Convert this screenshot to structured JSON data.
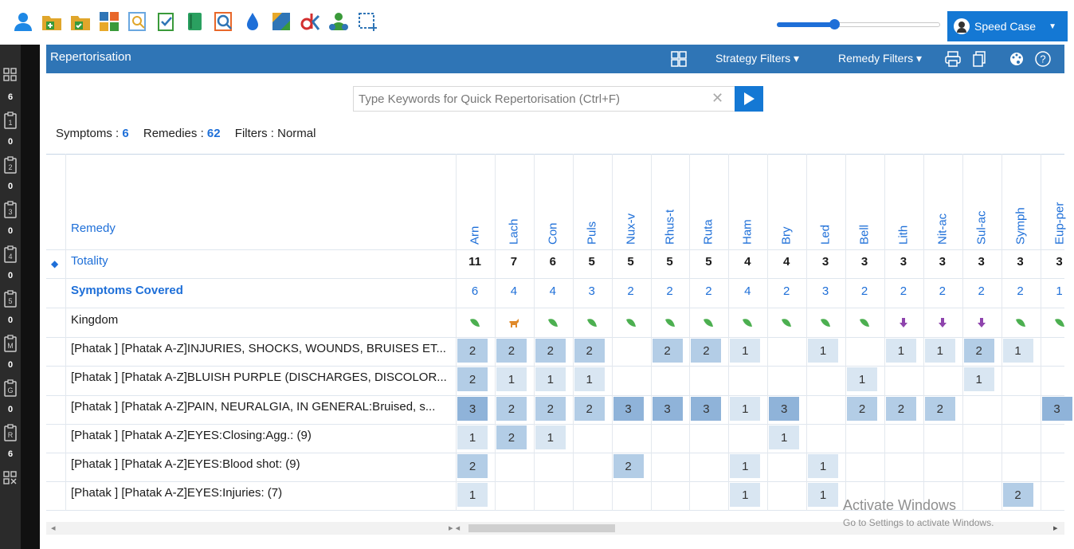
{
  "toolbar": {
    "icons": [
      "user-icon",
      "open-case-icon",
      "verified-folder-icon",
      "apps-grid-icon",
      "search-repertory-icon",
      "clipboard-icon",
      "book-icon",
      "zoom-search-icon",
      "drop-icon",
      "remedy-picture-icon",
      "dk-logo-icon",
      "patients-icon",
      "selection-icon"
    ]
  },
  "speed_case": {
    "label": "Speed Case"
  },
  "rail": {
    "items": [
      {
        "icon": "grid-icon",
        "count": "6"
      },
      {
        "icon": "clipboard-1-icon",
        "count": "0"
      },
      {
        "icon": "clipboard-2-icon",
        "count": "0"
      },
      {
        "icon": "clipboard-3-icon",
        "count": "0"
      },
      {
        "icon": "clipboard-4-icon",
        "count": "0"
      },
      {
        "icon": "clipboard-5-icon",
        "count": "0"
      },
      {
        "icon": "clipboard-m-icon",
        "count": "0"
      },
      {
        "icon": "clipboard-g-icon",
        "count": "0"
      },
      {
        "icon": "clipboard-r-icon",
        "count": "6"
      },
      {
        "icon": "grid-x-icon",
        "count": ""
      }
    ]
  },
  "header": {
    "title": "Repertorisation",
    "strategy_filters": "Strategy Filters",
    "remedy_filters": "Remedy Filters"
  },
  "search": {
    "placeholder": "Type Keywords for Quick Repertorisation (Ctrl+F)",
    "clear": "✕"
  },
  "summary": {
    "symptoms_label": "Symptoms :",
    "symptoms_value": "6",
    "remedies_label": "Remedies :",
    "remedies_value": "62",
    "filters_label": "Filters :",
    "filters_value": "Normal"
  },
  "table": {
    "remedy_header": "Remedy",
    "totality_label": "Totality",
    "covered_label": "Symptoms Covered",
    "kingdom_label": "Kingdom",
    "remedies": [
      "Arn",
      "Lach",
      "Con",
      "Puls",
      "Nux-v",
      "Rhus-t",
      "Ruta",
      "Ham",
      "Bry",
      "Led",
      "Bell",
      "Lith",
      "Nit-ac",
      "Sul-ac",
      "Symph",
      "Eup-per"
    ],
    "totality": [
      "11",
      "7",
      "6",
      "5",
      "5",
      "5",
      "5",
      "4",
      "4",
      "3",
      "3",
      "3",
      "3",
      "3",
      "3",
      "3"
    ],
    "covered": [
      "6",
      "4",
      "4",
      "3",
      "2",
      "2",
      "2",
      "4",
      "2",
      "3",
      "2",
      "2",
      "2",
      "2",
      "2",
      "1"
    ],
    "kingdom": [
      "plant",
      "animal",
      "plant",
      "plant",
      "plant",
      "plant",
      "plant",
      "plant",
      "plant",
      "plant",
      "plant",
      "mineral",
      "mineral",
      "mineral",
      "plant",
      "plant"
    ],
    "rows": [
      {
        "label": "[Phatak ] [Phatak A-Z]INJURIES, SHOCKS, WOUNDS, BRUISES ET...",
        "grades": [
          2,
          2,
          2,
          2,
          0,
          2,
          2,
          1,
          0,
          1,
          0,
          1,
          1,
          2,
          1,
          0
        ]
      },
      {
        "label": "[Phatak ] [Phatak A-Z]BLUISH PURPLE (DISCHARGES, DISCOLOR...",
        "grades": [
          2,
          1,
          1,
          1,
          0,
          0,
          0,
          0,
          0,
          0,
          1,
          0,
          0,
          1,
          0,
          0
        ]
      },
      {
        "label": "[Phatak ] [Phatak A-Z]PAIN, NEURALGIA, IN GENERAL:Bruised, s...",
        "grades": [
          3,
          2,
          2,
          2,
          3,
          3,
          3,
          1,
          3,
          0,
          2,
          2,
          2,
          0,
          0,
          3
        ]
      },
      {
        "label": "[Phatak ] [Phatak A-Z]EYES:Closing:Agg.: (9)",
        "grades": [
          1,
          2,
          1,
          0,
          0,
          0,
          0,
          0,
          1,
          0,
          0,
          0,
          0,
          0,
          0,
          0
        ]
      },
      {
        "label": "[Phatak ] [Phatak A-Z]EYES:Blood shot: (9)",
        "grades": [
          2,
          0,
          0,
          0,
          2,
          0,
          0,
          1,
          0,
          1,
          0,
          0,
          0,
          0,
          0,
          0
        ]
      },
      {
        "label": "[Phatak ] [Phatak A-Z]EYES:Injuries: (7)",
        "grades": [
          1,
          0,
          0,
          0,
          0,
          0,
          0,
          1,
          0,
          1,
          0,
          0,
          0,
          0,
          2,
          0
        ]
      }
    ]
  },
  "watermark": {
    "line1": "Activate Windows",
    "line2": "Go to Settings to activate Windows."
  },
  "colors": {
    "accent": "#1478d4",
    "header": "#2f75b6",
    "grade1": "#d9e6f2",
    "grade2": "#b3cde6",
    "grade3": "#8fb3d9"
  }
}
